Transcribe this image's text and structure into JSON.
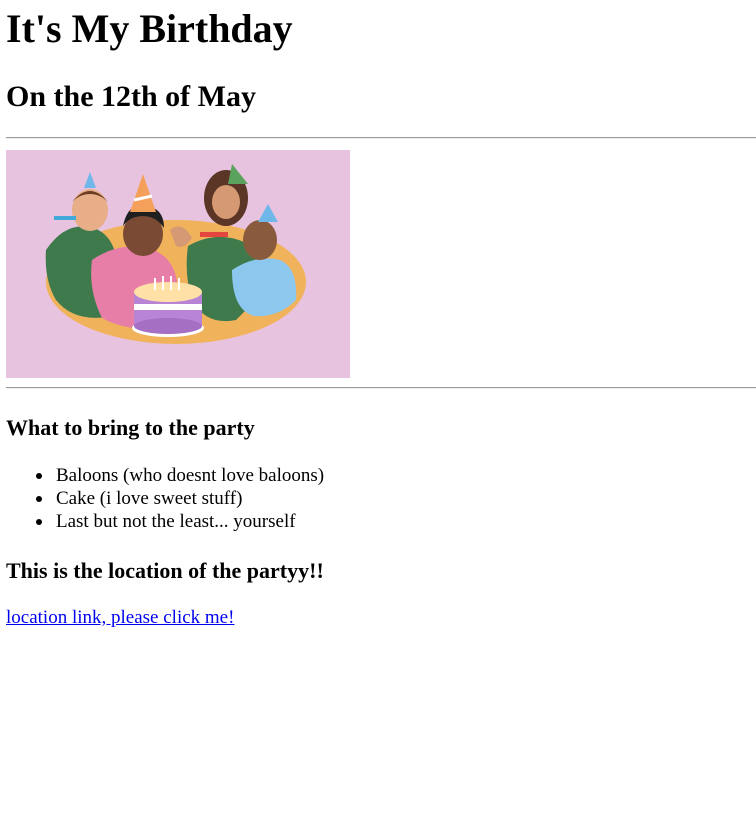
{
  "page": {
    "title": "It's My Birthday",
    "subtitle": "On the 12th of May",
    "hero_image_alt": "birthday party illustration"
  },
  "bring_section": {
    "heading": "What to bring to the party",
    "items": [
      "Baloons (who doesnt love baloons)",
      "Cake (i love sweet stuff)",
      "Last but not the least... yourself"
    ]
  },
  "location_section": {
    "heading": "This is the location of the partyy!!",
    "link_text": "location link, please click me!"
  },
  "colors": {
    "link": "#0000ee",
    "hero_background": "#e8c3e0",
    "rule": "#9a9a9a"
  }
}
